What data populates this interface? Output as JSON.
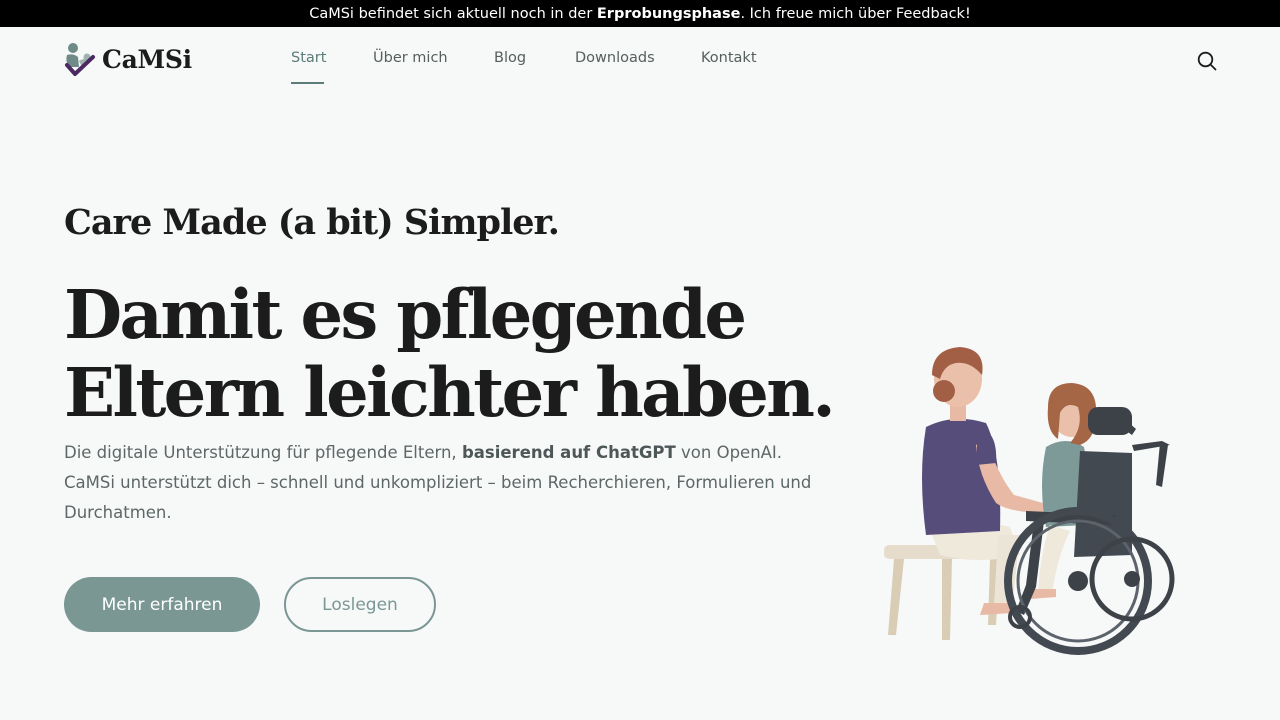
{
  "announcement": {
    "prefix": "CaMSi befindet sich aktuell noch in der",
    "bold": "Erprobungsphase",
    "suffix": ". Ich freue mich über Feedback!"
  },
  "brand": {
    "name": "CaMSi"
  },
  "nav": {
    "items": [
      {
        "label": "Start",
        "active": true
      },
      {
        "label": "Über mich"
      },
      {
        "label": "Blog"
      },
      {
        "label": "Downloads"
      },
      {
        "label": "Kontakt"
      }
    ]
  },
  "hero": {
    "tagline": "Care Made (a bit) Simpler.",
    "headline_line1": "Damit es pflegende",
    "headline_line2": "Eltern leichter haben.",
    "intro_before": "Die digitale Unterstützung für pflegende Eltern,",
    "intro_bold": "basierend auf ChatGPT",
    "intro_after": "von OpenAI.",
    "intro_line2": "CaMSi unterstützt dich – schnell und unkompliziert – beim Recherchieren, Formulieren und Durchatmen.",
    "primary_button": "Mehr erfahren",
    "secondary_button": "Loslegen"
  },
  "colors": {
    "accent": "#7a9794",
    "accent_dark": "#5b7c79",
    "background": "#f7f8f8",
    "text": "#1c1c1c"
  },
  "icons": [
    "camsi-logo-icon",
    "search-icon",
    "caregiver-wheelchair-illustration"
  ]
}
